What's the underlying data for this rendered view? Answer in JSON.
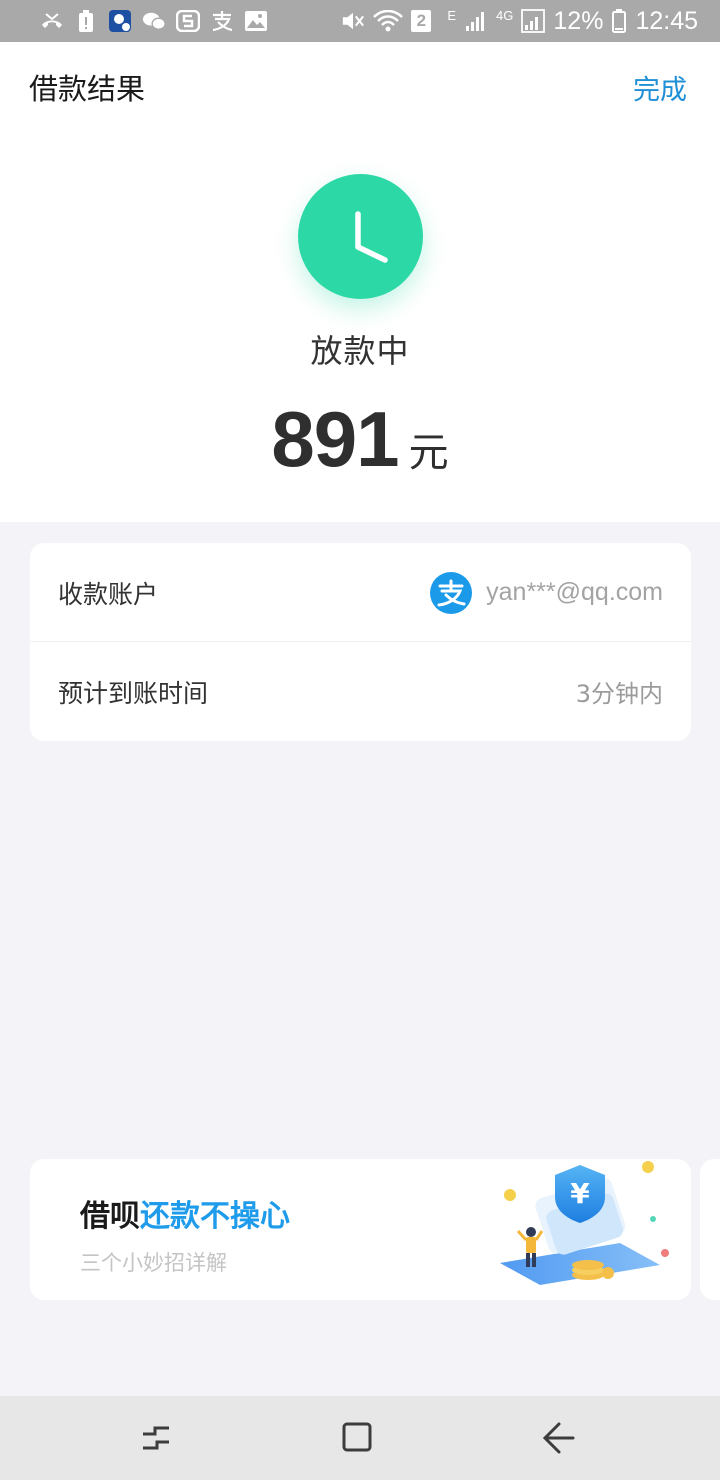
{
  "status_bar": {
    "sim_number": "2",
    "network_e": "E",
    "network_4g": "4G",
    "battery": "12%",
    "time": "12:45",
    "icons": [
      "missed-call-icon",
      "battery-alert-icon",
      "app-notification-icon",
      "wechat-icon",
      "s-app-icon",
      "alipay-notification-icon",
      "image-icon",
      "mute-icon",
      "wifi-icon",
      "signal-icon",
      "battery-icon"
    ]
  },
  "header": {
    "title": "借款结果",
    "done_label": "完成"
  },
  "result": {
    "status_text": "放款中",
    "amount": "891",
    "unit": "元",
    "icon": "clock-icon",
    "accent_color": "#2dd8a7"
  },
  "info": {
    "account_label": "收款账户",
    "account_value": "yan***@qq.com",
    "account_icon": "alipay-icon",
    "eta_label": "预计到账时间",
    "eta_value": "3分钟内"
  },
  "promo": {
    "title_prefix": "借呗",
    "title_highlight": "还款不操心",
    "subtitle": "三个小妙招详解",
    "highlight_color": "#1e9bea"
  },
  "nav": {
    "icons": [
      "recent-apps-icon",
      "home-icon",
      "back-icon"
    ]
  }
}
